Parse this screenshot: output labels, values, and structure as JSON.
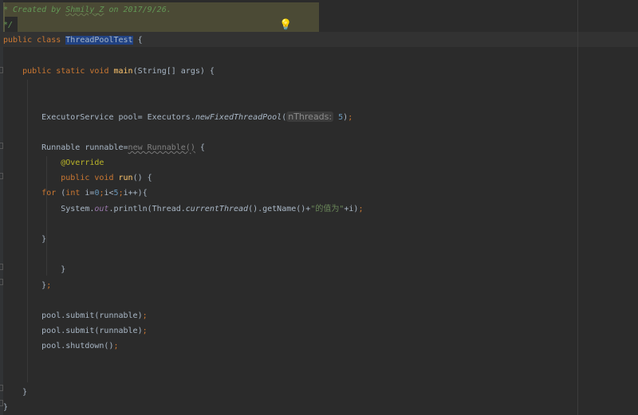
{
  "editor": {
    "lines": [
      [
        [
          "* Created by ",
          "doc"
        ],
        [
          "Shmily_Z",
          "docu"
        ],
        [
          " on 2017/9/26.",
          "doc"
        ]
      ],
      [
        [
          "*/",
          "doc"
        ]
      ],
      [
        [
          "public class ",
          "kw"
        ],
        [
          "ThreadPoolTest",
          "sel"
        ],
        [
          " {",
          ""
        ]
      ],
      [],
      [
        [
          "    ",
          ""
        ],
        [
          "public static void ",
          "kw"
        ],
        [
          "main",
          "fn"
        ],
        [
          "(String[] args) {",
          ""
        ]
      ],
      [],
      [],
      [
        [
          "        ExecutorService pool= Executors.",
          ""
        ],
        [
          "newFixedThreadPool",
          "it"
        ],
        [
          "(",
          ""
        ],
        [
          "nThreads:",
          "hint"
        ],
        [
          " ",
          ""
        ],
        [
          "5",
          "num"
        ],
        [
          ")",
          ""
        ],
        [
          ";",
          "kw"
        ]
      ],
      [],
      [
        [
          "        Runnable runnable=",
          ""
        ],
        [
          "new Runnable()",
          "grey"
        ],
        [
          " {",
          ""
        ]
      ],
      [
        [
          "            ",
          ""
        ],
        [
          "@Override",
          "ann"
        ]
      ],
      [
        [
          "            ",
          ""
        ],
        [
          "public void ",
          "kw"
        ],
        [
          "run",
          "fn"
        ],
        [
          "() {",
          ""
        ]
      ],
      [
        [
          "        ",
          ""
        ],
        [
          "for ",
          "kw"
        ],
        [
          "(",
          ""
        ],
        [
          "int ",
          "kw"
        ],
        [
          "i=",
          ""
        ],
        [
          "0",
          "num"
        ],
        [
          ";",
          "kw"
        ],
        [
          "i<",
          ""
        ],
        [
          "5",
          "num"
        ],
        [
          ";",
          "kw"
        ],
        [
          "i++){",
          ""
        ]
      ],
      [
        [
          "            System.",
          ""
        ],
        [
          "out",
          "field"
        ],
        [
          ".println(Thread.",
          ""
        ],
        [
          "currentThread",
          "it"
        ],
        [
          "().getName()+",
          ""
        ],
        [
          "\"的值为\"",
          "str"
        ],
        [
          "+i)",
          ""
        ],
        [
          ";",
          "kw"
        ]
      ],
      [],
      [
        [
          "        }",
          ""
        ]
      ],
      [],
      [
        [
          "            }",
          ""
        ]
      ],
      [
        [
          "        }",
          ""
        ],
        [
          ";",
          "kw"
        ]
      ],
      [],
      [
        [
          "        pool.submit(runnable)",
          ""
        ],
        [
          ";",
          "kw"
        ]
      ],
      [
        [
          "        pool.submit(runnable)",
          ""
        ],
        [
          ";",
          "kw"
        ]
      ],
      [
        [
          "        pool.shutdown()",
          ""
        ],
        [
          ";",
          "kw"
        ]
      ],
      [],
      [],
      [
        [
          "    }",
          ""
        ]
      ],
      [
        [
          "}",
          ""
        ]
      ]
    ]
  }
}
